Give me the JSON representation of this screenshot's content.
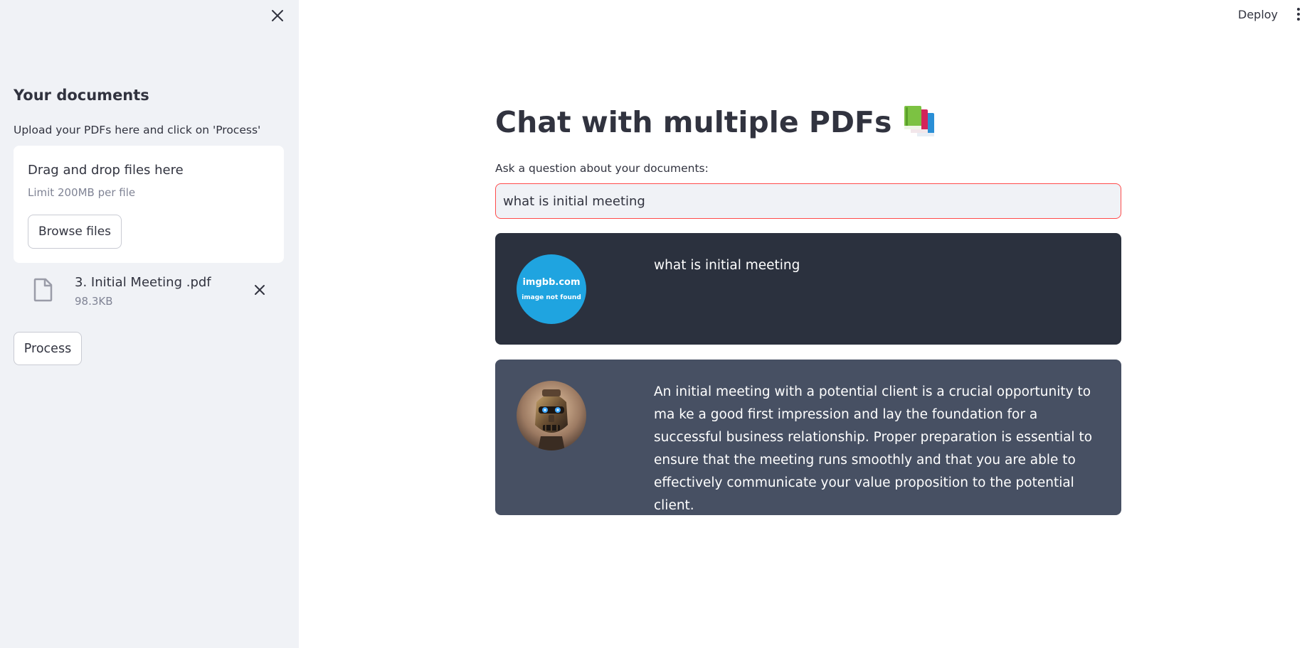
{
  "sidebar": {
    "heading": "Your documents",
    "caption": "Upload your PDFs here and click on 'Process'",
    "dropzone": {
      "title": "Drag and drop files here",
      "limit": "Limit 200MB per file",
      "browse_label": "Browse files"
    },
    "file": {
      "name": "3. Initial Meeting .pdf",
      "size": "98.3KB"
    },
    "process_label": "Process"
  },
  "header": {
    "deploy_label": "Deploy"
  },
  "main": {
    "title": "Chat with multiple PDFs",
    "title_icon": "books-icon",
    "question_label": "Ask a question about your documents:",
    "question_value": "what is initial meeting"
  },
  "chat": {
    "user": {
      "avatar_line1": "imgbb.com",
      "avatar_line2": "image not found",
      "message": "what is initial meeting"
    },
    "bot": {
      "avatar_icon": "robot-avatar",
      "message": "An initial meeting with a potential client is a crucial opportunity to ma ke a good first impression and lay the foundation for a successful business relationship. Proper preparation is essential to ensure that the meeting runs smoothly and that you are able to effectively communicate your value proposition to the potential client."
    }
  },
  "colors": {
    "sidebar_bg": "#f0f2f6",
    "accent": "#ff4b4b",
    "user_bubble": "#2b313e",
    "bot_bubble": "#475063",
    "imgbb_blue": "#1fa4e0"
  }
}
